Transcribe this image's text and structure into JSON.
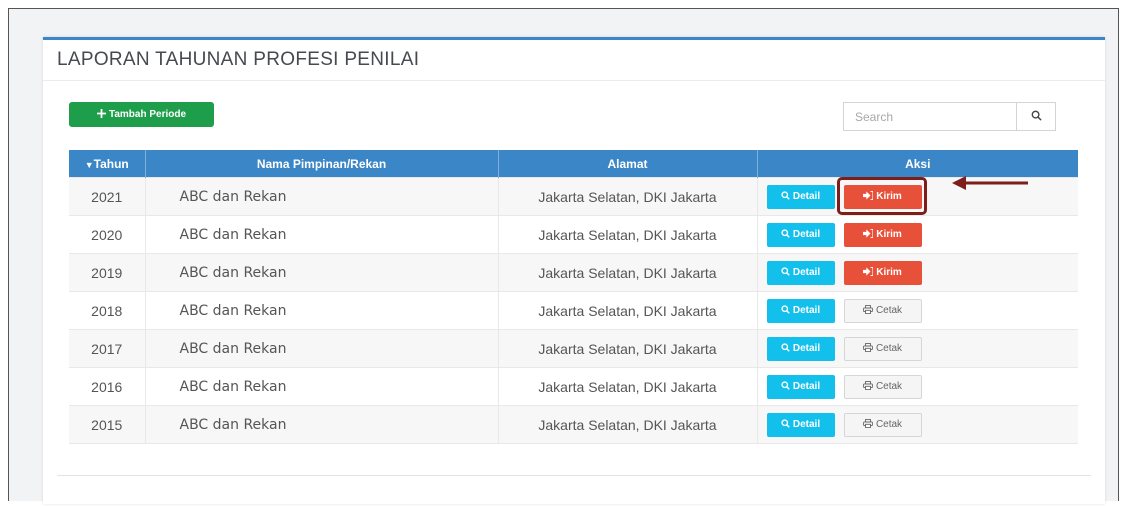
{
  "page": {
    "title": "LAPORAN TAHUNAN PROFESI PENILAI"
  },
  "toolbar": {
    "add_label": "Tambah Periode",
    "add_icon": "plus-icon",
    "search_placeholder": "Search",
    "search_icon": "magnifier-icon"
  },
  "table": {
    "headers": {
      "year": "Tahun",
      "name": "Nama Pimpinan/Rekan",
      "address": "Alamat",
      "actions": "Aksi"
    },
    "sort_icon": "sort-down-triangle-icon",
    "rows": [
      {
        "year": "2021",
        "name": "ABC dan Rekan",
        "address": "Jakarta Selatan, DKI Jakarta",
        "detail_label": "Detail",
        "action_label": "Kirim",
        "action_type": "kirim"
      },
      {
        "year": "2020",
        "name": "ABC dan Rekan",
        "address": "Jakarta Selatan, DKI Jakarta",
        "detail_label": "Detail",
        "action_label": "Kirim",
        "action_type": "kirim"
      },
      {
        "year": "2019",
        "name": "ABC dan Rekan",
        "address": "Jakarta Selatan, DKI Jakarta",
        "detail_label": "Detail",
        "action_label": "Kirim",
        "action_type": "kirim"
      },
      {
        "year": "2018",
        "name": "ABC dan Rekan",
        "address": "Jakarta Selatan, DKI Jakarta",
        "detail_label": "Detail",
        "action_label": "Cetak",
        "action_type": "cetak"
      },
      {
        "year": "2017",
        "name": "ABC dan Rekan",
        "address": "Jakarta Selatan, DKI Jakarta",
        "detail_label": "Detail",
        "action_label": "Cetak",
        "action_type": "cetak"
      },
      {
        "year": "2016",
        "name": "ABC dan Rekan",
        "address": "Jakarta Selatan, DKI Jakarta",
        "detail_label": "Detail",
        "action_label": "Cetak",
        "action_type": "cetak"
      },
      {
        "year": "2015",
        "name": "ABC dan Rekan",
        "address": "Jakarta Selatan, DKI Jakarta",
        "detail_label": "Detail",
        "action_label": "Cetak",
        "action_type": "cetak"
      }
    ]
  },
  "colors": {
    "header": "#3b86c6",
    "add_button": "#1e9e4a",
    "detail_button": "#13c0ec",
    "kirim_button": "#e7513a",
    "highlight": "#7e1d1a"
  }
}
